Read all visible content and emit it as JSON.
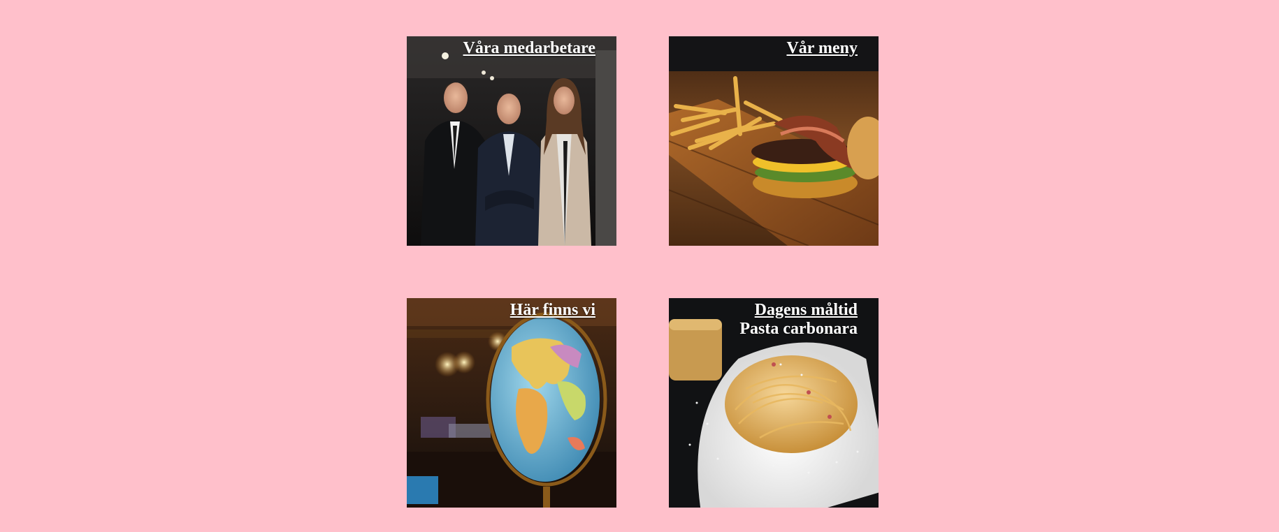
{
  "page": {
    "background_color": "#ffc0cb"
  },
  "tiles": [
    {
      "link_text": "Våra medarbetare",
      "image": "staff-photo"
    },
    {
      "link_text": "Vår meny",
      "image": "burger-and-fries-photo"
    },
    {
      "link_text": "Här finns vi",
      "image": "globe-photo"
    },
    {
      "link_text": "Dagens måltid",
      "subtitle": "Pasta carbonara",
      "image": "pasta-carbonara-photo"
    }
  ]
}
